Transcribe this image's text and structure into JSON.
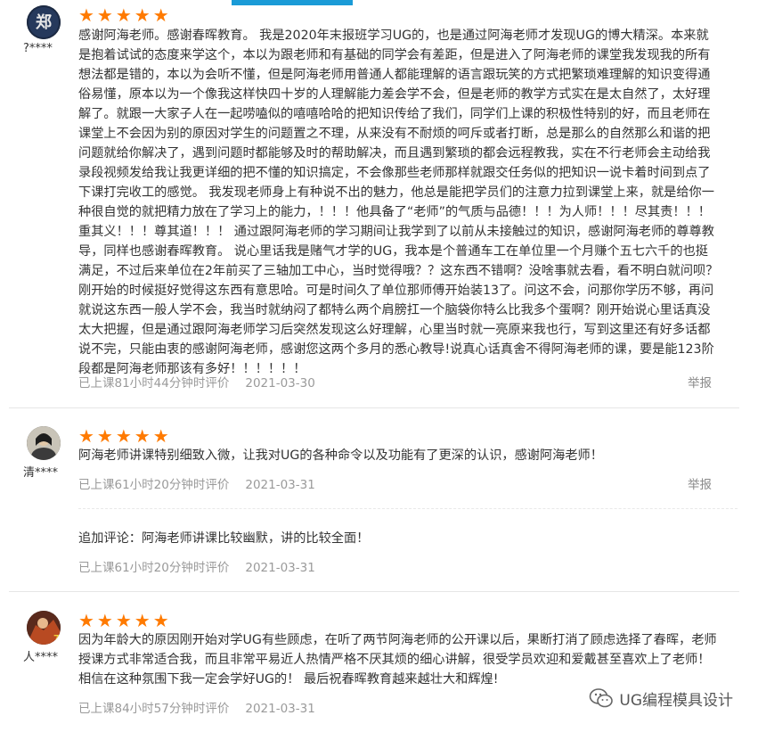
{
  "reviews": [
    {
      "username": "?****",
      "stars": "★★★★★",
      "content": "感谢阿海老师。感谢春晖教育。 我是2020年末报班学习UG的，也是通过阿海老师才发现UG的博大精深。本来就是抱着试试的态度来学这个，本以为跟老师和有基础的同学会有差距，但是进入了阿海老师的课堂我发现我的所有想法都是错的，本以为会听不懂，但是阿海老师用普通人都能理解的语言跟玩笑的方式把繁琐难理解的知识变得通俗易懂，原本以为一个像我这样快四十岁的人理解能力差会学不会，但是老师的教学方式实在是太自然了，太好理解了。就跟一大家子人在一起唠嗑似的嘻嘻哈哈的把知识传给了我们，同学们上课的积极性特别的好，而且老师在课堂上不会因为别的原因对学生的问题置之不理，从来没有不耐烦的呵斥或者打断，总是那么的自然那么和谐的把问题就给你解决了，遇到问题时都能够及时的帮助解决，而且遇到繁琐的都会远程教我，实在不行老师会主动给我录段视频发给我让我更详细的把不懂的知识搞定，不会像那些老师那样就跟交任务似的把知识一说卡着时间到点了下课打完收工的感觉。 我发现老师身上有种说不出的魅力，他总是能把学员们的注意力拉到课堂上来，就是给你一种很自觉的就把精力放在了学习上的能力，！！！他具备了“老师”的气质与品德！！！为人师！！！尽其责！！！重其义！！！尊其道！！！ 通过跟阿海老师的学习期间让我学到了以前从未接触过的知识，感谢阿海老师的尊尊教导，同样也感谢春晖教育。 说心里话我是赌气才学的UG，我本是个普通车工在单位里一个月赚个五七六千的也挺满足，不过后来单位在2年前买了三轴加工中心，当时觉得哦？？这东西不错啊？没啥事就去看，看不明白就问呗？刚开始的时候挺好觉得这东西有意思哈。可是时间久了单位那师傅开始装13了。问这不会，问那你学历不够，再问就说这东西一般人学不会，我当时就纳闷了都特么两个肩膀扛一个脑袋你特么比我多个蛋啊？刚开始说心里话真没太大把握，但是通过跟阿海老师学习后突然发现这么好理解，心里当时就一亮原来我也行，写到这里还有好多话都说不完，只能由衷的感谢阿海老师，感谢您这两个多月的悉心教导!说真心话真舍不得阿海老师的课，要是能123阶段都是阿海老师那该有多好！！！！！！",
      "meta": "已上课81小时44分钟时评价",
      "date": "2021-03-30",
      "report": "举报"
    },
    {
      "username": "清****",
      "stars": "★★★★★",
      "content": "阿海老师讲课特别细致入微，让我对UG的各种命令以及功能有了更深的认识，感谢阿海老师！",
      "meta": "已上课61小时20分钟时评价",
      "date": "2021-03-31",
      "report": "举报",
      "followup": {
        "content": "追加评论：阿海老师讲课比较幽默，讲的比较全面！",
        "meta": "已上课61小时20分钟时评价",
        "date": "2021-03-31"
      }
    },
    {
      "username": "人****",
      "stars": "★★★★★",
      "content": "因为年龄大的原因刚开始对学UG有些顾虑，在听了两节阿海老师的公开课以后，果断打消了顾虑选择了春晖，老师授课方式非常适合我，而且非常平易近人热情严格不厌其烦的细心讲解，很受学员欢迎和爱戴甚至喜欢上了老师！相信在这种氛围下我一定会学好UG的！ 最后祝春晖教育越来越壮大和辉煌!",
      "meta": "已上课84小时57分钟时评价",
      "date": "2021-03-31"
    }
  ],
  "watermark": "UG编程模具设计",
  "colors": {
    "star": "#ff7a00",
    "accent": "#1a9bd7",
    "meta": "#9a9a9a"
  }
}
